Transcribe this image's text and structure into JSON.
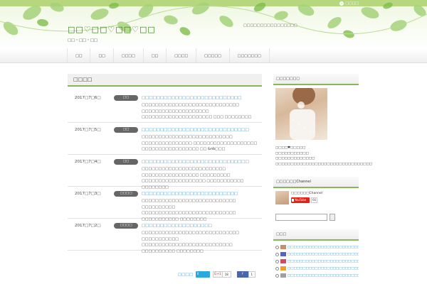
{
  "header": {
    "login_label": "□□□□",
    "site_title": "□□♡□□♡□□♡□□",
    "site_subtitle": "□□・□□・□□",
    "catch_copy": "□□□□□□□□□□□□□□□□"
  },
  "nav": {
    "items": [
      {
        "label": "□□"
      },
      {
        "label": "□□"
      },
      {
        "label": "□□□□"
      },
      {
        "label": "□□"
      },
      {
        "label": "□□□□"
      },
      {
        "label": "□□□□□"
      },
      {
        "label": "□□□□□□□"
      }
    ]
  },
  "main": {
    "section_title": "□□□□",
    "posts": [
      {
        "date": "2017□7□6□",
        "category": "□□",
        "title": "□□□□□□□□□□□□□□□□□□□□□□□□□□□",
        "excerpt": "□□□□□□□□□□□□□□□□□□□□□□□□□□□□□ □□□□□□□□□□□□□□□□□□□□ □□□□□□□□□□□□□□□□□□□□□ □□□ □□□□□□□□"
      },
      {
        "date": "2017□7□5□",
        "category": "□□",
        "title": "□□□□□□□□□□□□□□□□□□□□□□□□□□□□□",
        "excerpt": "□□□□□□□□□□□□□□□□□□□□□□□□□□□ □□□□□□□□□□□□□□□ □□□□□□□□□□□□□□□□□□□ □□□□□□□□□□□□□□□□□ □□ &nb□□□"
      },
      {
        "date": "2017□7□4□",
        "category": "□□",
        "title": "□□□□□□□□□□□□□□□□□□□□□□□□□□□□□",
        "excerpt": "□□□□□□□□□□□□□□□□□□□□□□□□□ □□□□□□□□□□□□□□□□□ □□□□□□□□□ □□□□□□□□□□□□□□□□□□□ □□□□□□□□□□□ □□□□□□□□"
      },
      {
        "date": "2017□7□3□",
        "category": "□□□□",
        "title": "□□□□□□□□□□□□□□□□□□□□□□□□□□",
        "excerpt": "□□□□□□□□□□□□□□□□□□□□□□□□□□□□ □□□□□□□□□□ □□□□□□□□□□□□□□□□□□□□□□□□□□□□ □□□□□□□□□□□ □□□□□□□□"
      },
      {
        "date": "2017□7□2□",
        "category": "□□□□",
        "title": "□□□□□□□□□□□□□□□□□□□",
        "excerpt": "□□□□□□□□□□□□□□□□□□□□□□□□□□□□□ □□□□□□□□□□□ □□□□□□□□□□□□□□□□□□□□□□□□□□□ □□□□□□□□□□ □□□□□□□□"
      }
    ]
  },
  "share": {
    "label": "□□□□",
    "twitter_count": "0",
    "gplus_label": "G+1",
    "gplus_count": "18",
    "facebook_label": "f",
    "facebook_count": "1"
  },
  "sidebar": {
    "profile_title": "□□□□□□□",
    "profile_lines": [
      "□□□□♥□□□□□",
      "□□□□□□□□□□□",
      "□□□□□□□□□□□□□",
      "□□□□□□□□□□□□□□□□□□□□□□□□□□□□□□□□"
    ],
    "youtube_title": "□□□□□□Channel",
    "youtube_name": "□□□□□□Channel",
    "youtube_button": "YouTube",
    "youtube_count": "66",
    "recent_title": "□□□",
    "recent_items": [
      {
        "title": "□□□□□□□□□□□□□□□□□□□□□□□□□□□□□□"
      },
      {
        "title": "□□□□□□□□□□□□□□□□□□□□□□□□□□□□□□"
      },
      {
        "title": "□□□□□□□□□□□□□□□□□□□□□□□□□□□□□□"
      },
      {
        "title": "□□□□□□□□□□□□□□□□□□□□□□□□□□□□□□"
      },
      {
        "title": "□□□□□□□□□□□□□□□□□□□□□□□□□□□□□□"
      }
    ]
  },
  "colors": {
    "accent_green": "#86b85a",
    "link_blue": "#2a8fc6",
    "title_green": "#2b7a0b"
  }
}
